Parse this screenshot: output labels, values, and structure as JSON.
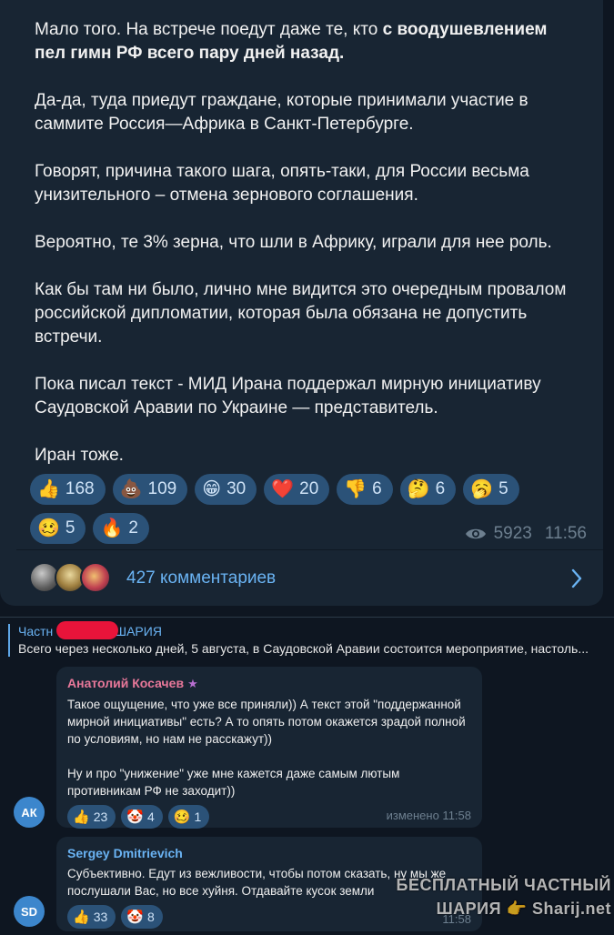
{
  "post": {
    "paragraphs": [
      {
        "plain": "Мало того. На встрече поедут даже те, кто ",
        "bold": "с воодушевлением пел гимн РФ всего пару дней назад."
      },
      {
        "plain": "Да-да, туда приедут  граждане, которые принимали участие в саммите Россия—Африка в Санкт-Петербурге.",
        "bold": ""
      },
      {
        "plain": "Говорят, причина такого шага, опять-таки, для России весьма унизительного – отмена зернового соглашения.",
        "bold": ""
      },
      {
        "plain": "Вероятно, те 3% зерна, что шли в Африку, играли для нее роль.",
        "bold": ""
      },
      {
        "plain": "Как бы там ни было, лично мне видится это очередным провалом российской дипломатии, которая была обязана не допустить встречи.",
        "bold": ""
      },
      {
        "plain": "Пока писал текст - МИД Ирана поддержал мирную инициативу Саудовской Аравии по Украине — представитель.",
        "bold": ""
      },
      {
        "plain": "Иран тоже.",
        "bold": ""
      }
    ],
    "reactions": [
      {
        "emoji": "👍",
        "icon": "thumbs-up",
        "count": "168"
      },
      {
        "emoji": "💩",
        "icon": "poop",
        "count": "109"
      },
      {
        "emoji": "😁",
        "icon": "grin",
        "count": "30"
      },
      {
        "emoji": "❤️",
        "icon": "heart",
        "count": "20"
      },
      {
        "emoji": "👎",
        "icon": "thumbs-down",
        "count": "6"
      },
      {
        "emoji": "🤔",
        "icon": "thinking",
        "count": "6"
      },
      {
        "emoji": "🥱",
        "icon": "yawn",
        "count": "5"
      },
      {
        "emoji": "🥴",
        "icon": "woozy",
        "count": "5"
      },
      {
        "emoji": "🔥",
        "icon": "fire",
        "count": "2"
      }
    ],
    "views": "5923",
    "time": "11:56",
    "comments_label": "427 комментариев"
  },
  "pinned": {
    "title_left": "Частн",
    "title_right": "ШАРИЯ",
    "text": "Всего через несколько дней, 5 августа, в Саудовской Аравии состоится мероприятие, настоль..."
  },
  "comments": [
    {
      "author": "Анатолий Косачев",
      "initials": "АК",
      "text": "Такое ощущение, что уже все приняли)) А текст этой \"поддержанной мирной инициативы\" есть? А то опять потом окажется зрадой полной по условиям, но нам не расскажут))\n\nНу и про \"унижение\" уже мне кажется даже самым лютым противникам РФ не заходит))",
      "reactions": [
        {
          "emoji": "👍",
          "icon": "thumbs-up",
          "count": "23"
        },
        {
          "emoji": "🤡",
          "icon": "clown",
          "count": "4"
        },
        {
          "emoji": "🥴",
          "icon": "woozy",
          "count": "1"
        }
      ],
      "meta": "изменено 11:58"
    },
    {
      "author": "Sergey Dmitrievich",
      "initials": "SD",
      "text": "Субъективно. Едут из вежливости, чтобы потом сказать, ну мы же послушали Вас, но все хуйня. Отдавайте кусок земли",
      "reactions": [
        {
          "emoji": "👍",
          "icon": "thumbs-up",
          "count": "33"
        },
        {
          "emoji": "🤡",
          "icon": "clown",
          "count": "8"
        }
      ],
      "meta": "11:58"
    }
  ],
  "watermark": {
    "line1": "БЕСПЛАТНЫЙ ЧАСТНЫЙ",
    "line2": "ШАРИЯ 👉 Sharij.net"
  },
  "colors": {
    "bg": "#0e1621",
    "bubble": "#182533",
    "chip": "#2b5278",
    "link": "#6ab3f3",
    "meta": "#6d7f8f"
  }
}
